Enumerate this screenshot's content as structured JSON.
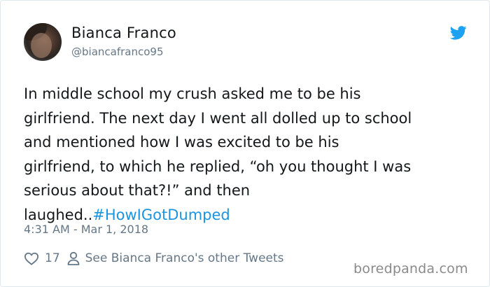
{
  "user": {
    "name": "Bianca Franco",
    "handle": "@biancafranco95"
  },
  "icons": {
    "logo": "twitter-bird-icon",
    "like": "heart-icon",
    "profile": "person-icon"
  },
  "colors": {
    "twitter_blue": "#1b95e0",
    "secondary_text": "#657786"
  },
  "tweet": {
    "lines": [
      "In middle school my crush asked me to be his",
      "girlfriend. The next day I went all dolled up to school",
      "and mentioned how I was excited to be his",
      "girlfriend, to which he replied, “oh you thought I was",
      "serious about that?!” and then",
      "laughed.."
    ],
    "hashtag": "#HowIGotDumped",
    "timestamp": "4:31 AM - Mar 1, 2018"
  },
  "actions": {
    "likes": "17",
    "other_tweets_label": "See Bianca Franco's other Tweets"
  },
  "watermark": "boredpanda.com"
}
